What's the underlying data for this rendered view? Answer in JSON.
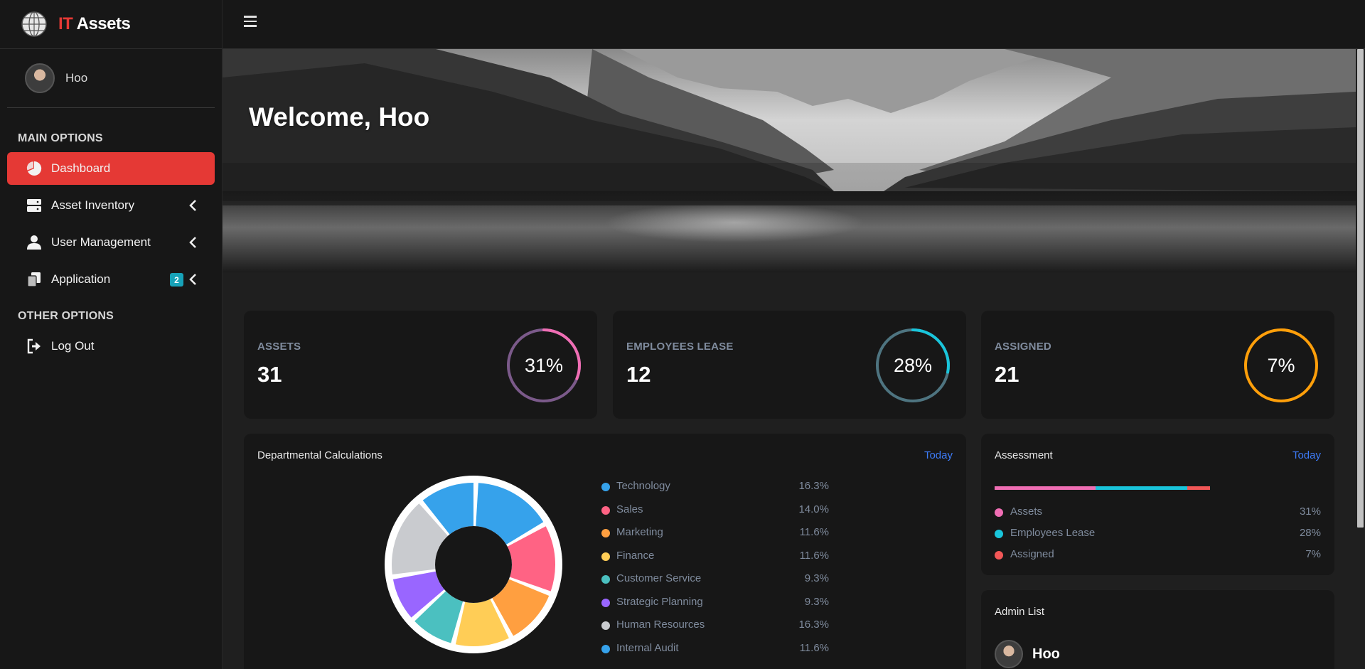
{
  "brand": {
    "prefix": "IT",
    "suffix": "Assets"
  },
  "user": {
    "name": "Hoo"
  },
  "sidebar": {
    "main_title": "MAIN OPTIONS",
    "other_title": "OTHER OPTIONS",
    "items": [
      {
        "label": "Dashboard",
        "icon": "pie-chart-icon",
        "active": true
      },
      {
        "label": "Asset Inventory",
        "icon": "server-icon"
      },
      {
        "label": "User Management",
        "icon": "user-icon"
      },
      {
        "label": "Application",
        "icon": "copy-icon",
        "badge": "2"
      }
    ],
    "logout": {
      "label": "Log Out",
      "icon": "sign-out-icon"
    }
  },
  "hero": {
    "welcome": "Welcome, Hoo"
  },
  "stats": [
    {
      "label": "ASSETS",
      "value": "31",
      "percent_label": "31%",
      "percent": 31,
      "color": "#f06eb4",
      "track": "#7b5a8a"
    },
    {
      "label": "EMPLOYEES LEASE",
      "value": "12",
      "percent_label": "28%",
      "percent": 28,
      "color": "#19c5db",
      "track": "#4e7480"
    },
    {
      "label": "ASSIGNED",
      "value": "21",
      "percent_label": "7%",
      "percent": 7,
      "color": "#ff9f0a",
      "track": "#ff9f0a"
    }
  ],
  "departments": {
    "title": "Departmental Calculations",
    "link": "Today",
    "items": [
      {
        "name": "Technology",
        "value": "16.3%",
        "color": "#36a2eb"
      },
      {
        "name": "Sales",
        "value": "14.0%",
        "color": "#ff6384"
      },
      {
        "name": "Marketing",
        "value": "11.6%",
        "color": "#ff9f40"
      },
      {
        "name": "Finance",
        "value": "11.6%",
        "color": "#ffcd56"
      },
      {
        "name": "Customer Service",
        "value": "9.3%",
        "color": "#4bc0c0"
      },
      {
        "name": "Strategic Planning",
        "value": "9.3%",
        "color": "#9966ff"
      },
      {
        "name": "Human Resources",
        "value": "16.3%",
        "color": "#c9cbcf"
      },
      {
        "name": "Internal Audit",
        "value": "11.6%",
        "color": "#36a2eb"
      }
    ]
  },
  "chart_data": {
    "type": "pie",
    "categories": [
      "Technology",
      "Sales",
      "Marketing",
      "Finance",
      "Customer Service",
      "Strategic Planning",
      "Human Resources",
      "Internal Audit"
    ],
    "values": [
      16.3,
      14.0,
      11.6,
      11.6,
      9.3,
      9.3,
      16.3,
      11.6
    ],
    "colors": [
      "#36a2eb",
      "#ff6384",
      "#ff9f40",
      "#ffcd56",
      "#4bc0c0",
      "#9966ff",
      "#c9cbcf",
      "#36a2eb"
    ],
    "title": "Departmental Calculations"
  },
  "assessment": {
    "title": "Assessment",
    "link": "Today",
    "items": [
      {
        "name": "Assets",
        "value": "31%",
        "percent": 31,
        "color": "#f06eb4"
      },
      {
        "name": "Employees Lease",
        "value": "28%",
        "percent": 28,
        "color": "#19c5db"
      },
      {
        "name": "Assigned",
        "value": "7%",
        "percent": 7,
        "color": "#f25757"
      }
    ]
  },
  "admin": {
    "title": "Admin List",
    "items": [
      {
        "name": "Hoo"
      }
    ]
  }
}
